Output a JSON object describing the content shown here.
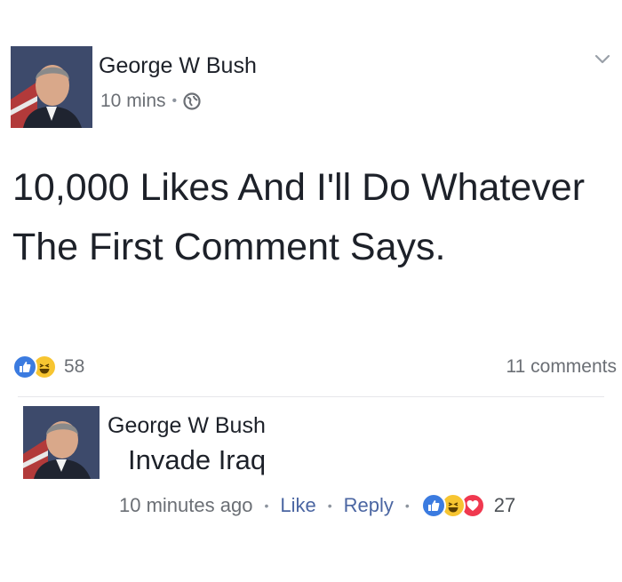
{
  "post": {
    "author": "George W Bush",
    "time": "10 mins",
    "privacy_icon": "globe-icon",
    "text": "10,000 Likes And I'll Do Whatever The First Comment Says.",
    "reactions": [
      "like",
      "haha"
    ],
    "reaction_count": "58",
    "comments_count": "11 comments"
  },
  "comment": {
    "author": "George W Bush",
    "text": "Invade Iraq",
    "time": "10 minutes ago",
    "like_label": "Like",
    "reply_label": "Reply",
    "reactions": [
      "like",
      "haha",
      "love"
    ],
    "reaction_count": "27"
  },
  "colors": {
    "like": "#3b7be0",
    "haha": "#f7c531",
    "love": "#f0384f",
    "link": "#4b66a2",
    "meta": "#6b6f75"
  }
}
